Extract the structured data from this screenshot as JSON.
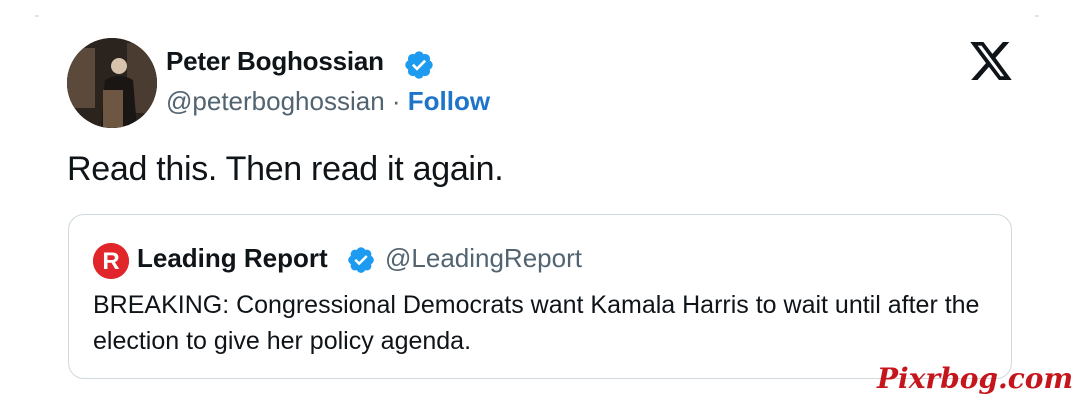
{
  "author": {
    "name": "Peter Boghossian",
    "handle": "@peterboghossian",
    "separator": " · ",
    "follow_label": "Follow"
  },
  "tweet": {
    "text": "Read this. Then read it again."
  },
  "quote": {
    "name": "Leading Report",
    "handle": "@LeadingReport",
    "avatar_letter": "R",
    "text": "BREAKING: Congressional Democrats want Kamala Harris to wait until after the election to give her policy agenda."
  },
  "watermark": "Pixrbog.com",
  "icons": {
    "verified": "verified-badge-icon",
    "platform": "x-logo-icon"
  },
  "colors": {
    "verified_blue": "#1d9bf0",
    "follow_blue": "#1d74c8",
    "watermark_red": "#c5161d",
    "leading_report_red": "#e0262a"
  }
}
